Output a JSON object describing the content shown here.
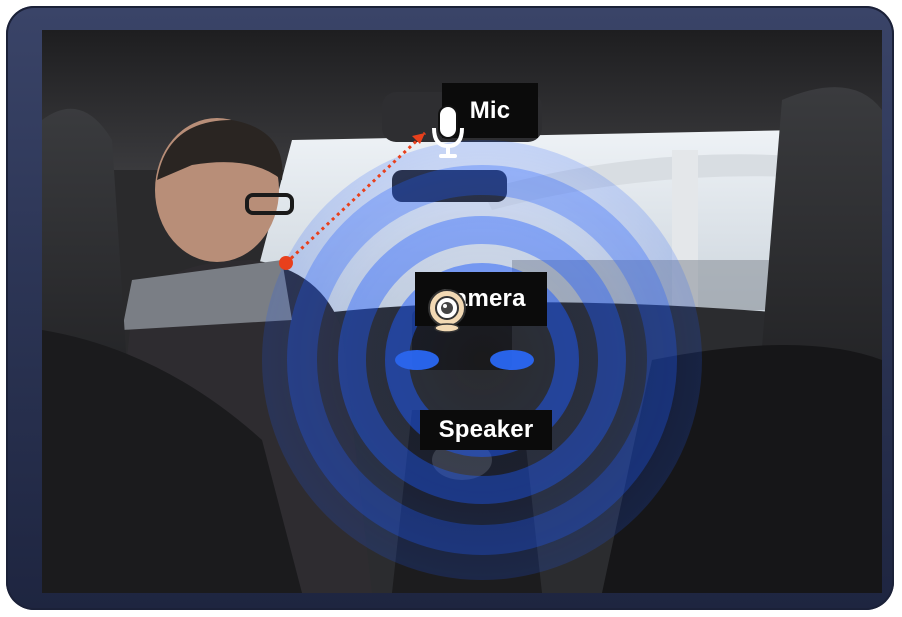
{
  "labels": {
    "mic": "Mic",
    "camera": "Camera",
    "speaker": "Speaker"
  },
  "icons": {
    "mic": "microphone-icon",
    "camera": "webcam-icon"
  },
  "colors": {
    "frame": "#2c3555",
    "label_bg": "#0b0b0b",
    "label_text": "#ffffff",
    "sound_wave": "#1f5bff",
    "pointer": "#e8401c"
  }
}
